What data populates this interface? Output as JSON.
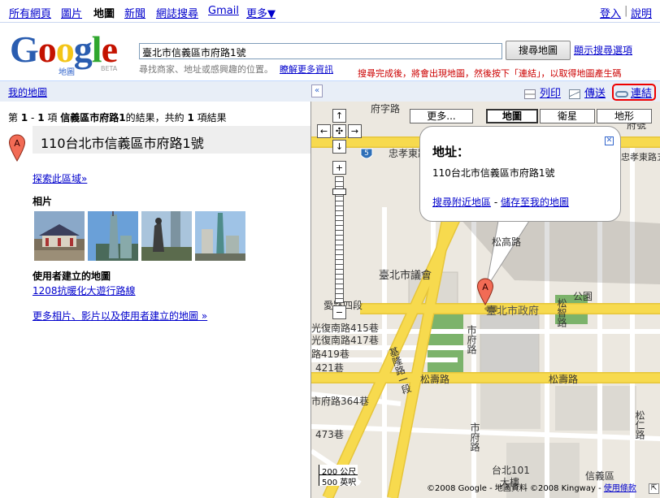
{
  "topnav": {
    "items": [
      "所有網頁",
      "圖片",
      "地圖",
      "新聞",
      "網誌搜尋",
      "Gmail",
      "更多▼"
    ],
    "active_index": 2,
    "signin": "登入",
    "help": "說明",
    "separator": "|"
  },
  "logo": {
    "text": "Google",
    "subtitle": "地圖",
    "beta": "BETA"
  },
  "search": {
    "value": "臺北市信義區市府路1號",
    "button": "搜尋地圖",
    "options": "顯示搜尋選項",
    "hint": "尋找商家、地址或感興趣的位置。",
    "learn_more": "瞭解更多資訊"
  },
  "annotation": "搜尋完成後，將會出現地圖，然後按下「連結」，以取得地圖產生碼",
  "toolbar": {
    "my_maps": "我的地圖",
    "collapse": "«",
    "print": "列印",
    "send": "傳送",
    "link": "連結"
  },
  "results": {
    "summary_prefix": "第",
    "range_start": "1",
    "range_dash": "-",
    "range_end": "1",
    "summary_mid": "項",
    "query": "信義區市府路1",
    "summary_of": "的結果，共約",
    "total": "1",
    "summary_suffix": "項結果",
    "marker": "A",
    "title": "110台北市信義區市府路1號",
    "explore": "探索此區域»",
    "photos_heading": "相片",
    "user_maps_heading": "使用者建立的地圖",
    "user_map_link": "1208抗暖化大遊行路線",
    "more_link": "更多相片、影片以及使用者建立的地圖 »"
  },
  "map": {
    "types": {
      "more": "更多...",
      "map": "地圖",
      "satellite": "衛星",
      "terrain": "地形"
    },
    "selected_type": "地圖",
    "zoom": {
      "up": "↑",
      "down": "↓",
      "left": "←",
      "right": "→",
      "center": "✣",
      "plus": "+",
      "minus": "−"
    },
    "route_shield": "5",
    "popup": {
      "title": "地址：",
      "address": "110台北市信義區市府路1號",
      "nearby": "搜尋附近地區",
      "dash": "-",
      "save": "儲存至我的地圖",
      "close": "✕"
    },
    "labels": {
      "zhongxiao": "忠孝東路",
      "zhongxiao5": "臺北市忠孝東路五段",
      "songshou": "松壽路",
      "songshou2": "松壽路",
      "aiguo": "愛路四段",
      "guangfu415": "光復南路415巷",
      "guangfu417": "光復南路417巷",
      "lane419": "路419巷",
      "lane421": "421巷",
      "lane364": "市府路364巷",
      "lane473": "473巷",
      "council": "臺北市議會",
      "cityhall": "臺北市政府",
      "park": "公園",
      "shifu": "市府路",
      "shifu2": "市府路",
      "keelung": "基隆路一段",
      "songgao": "松高路",
      "songzhi": "松智路",
      "taipei101": "台北101",
      "building": "大樓",
      "xinyi": "信義區",
      "marker": "A",
      "top1": "府字路",
      "top2": "府號",
      "songren": "松仁路"
    },
    "scale_top": "200 公尺",
    "scale_bottom": "500 英呎",
    "copyright": "©2008 Google - 地圖資料 ©2008 Kingway - ",
    "terms": "使用條款"
  },
  "colors": {
    "link": "#0000cc",
    "annotation": "#cc0000",
    "bar": "#e8eef7",
    "road_yellow": "#f7da4e",
    "park": "#7cb36b",
    "block": "#d6d4d0"
  }
}
